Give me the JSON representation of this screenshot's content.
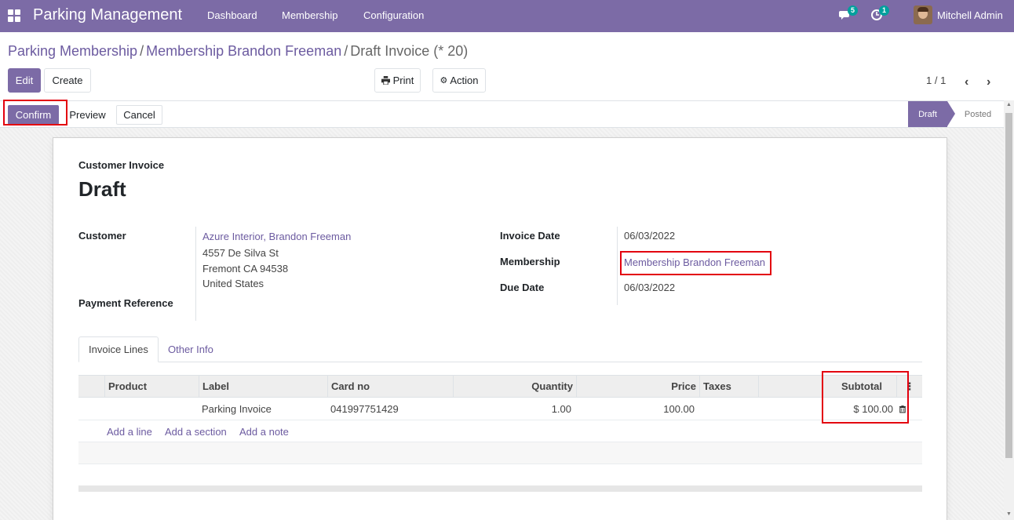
{
  "navbar": {
    "app_title": "Parking Management",
    "menus": [
      "Dashboard",
      "Membership",
      "Configuration"
    ],
    "messages_count": "5",
    "activities_count": "1",
    "user_name": "Mitchell Admin"
  },
  "breadcrumb": {
    "items": [
      "Parking Membership",
      "Membership Brandon Freeman"
    ],
    "current": "Draft Invoice (* 20)"
  },
  "toolbar": {
    "edit": "Edit",
    "create": "Create",
    "print": "Print",
    "action": "Action",
    "pager": "1 / 1"
  },
  "statusbar": {
    "confirm": "Confirm",
    "preview": "Preview",
    "cancel": "Cancel",
    "stages": [
      "Draft",
      "Posted"
    ],
    "active_stage": "Draft"
  },
  "invoice": {
    "type_label": "Customer Invoice",
    "state": "Draft",
    "customer_label": "Customer",
    "customer_name": "Azure Interior, Brandon Freeman",
    "address_lines": [
      "4557 De Silva St",
      "Fremont CA 94538",
      "United States"
    ],
    "payment_reference_label": "Payment Reference",
    "invoice_date_label": "Invoice Date",
    "invoice_date": "06/03/2022",
    "membership_label": "Membership",
    "membership": "Membership Brandon Freeman",
    "due_date_label": "Due Date",
    "due_date": "06/03/2022"
  },
  "tabs": [
    "Invoice Lines",
    "Other Info"
  ],
  "lines": {
    "columns": [
      "Product",
      "Label",
      "Card no",
      "Quantity",
      "Price",
      "Taxes",
      "Subtotal"
    ],
    "rows": [
      {
        "product": "",
        "label": "Parking Invoice",
        "card_no": "041997751429",
        "quantity": "1.00",
        "price": "100.00",
        "taxes": "",
        "subtotal": "$ 100.00"
      }
    ],
    "add_line": "Add a line",
    "add_section": "Add a section",
    "add_note": "Add a note"
  },
  "colors": {
    "brand": "#7c6ba6",
    "link": "#6c5ba0",
    "highlight": "#e3000f"
  }
}
